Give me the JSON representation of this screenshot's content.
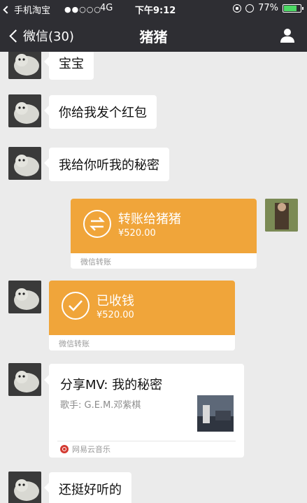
{
  "status_bar": {
    "carrier_back": "手机淘宝",
    "signal": "●●○○○",
    "network": "4G",
    "time": "下午9:12",
    "battery_percent": "77%",
    "battery_level": 0.77
  },
  "nav": {
    "back_label": "微信(30)",
    "title": "猪猪"
  },
  "messages": [
    {
      "type": "text",
      "from": "other",
      "text": "宝宝"
    },
    {
      "type": "text",
      "from": "other",
      "text": "你给我发个红包"
    },
    {
      "type": "text",
      "from": "other",
      "text": "我给你听我的秘密"
    },
    {
      "type": "transfer",
      "from": "me",
      "title": "转账给猪猪",
      "amount": "¥520.00",
      "footer": "微信转账"
    },
    {
      "type": "transfer",
      "from": "other",
      "title": "已收钱",
      "amount": "¥520.00",
      "footer": "微信转账"
    },
    {
      "type": "music",
      "from": "other",
      "title": "分享MV: 我的秘密",
      "artist": "歌手: G.E.M.邓紫棋",
      "source": "网易云音乐"
    },
    {
      "type": "text",
      "from": "other",
      "text": "还挺好听的"
    }
  ],
  "colors": {
    "bar_bg": "#2e2e33",
    "chat_bg": "#ebebeb",
    "transfer_orange": "#f0a53a",
    "battery_green": "#4cd964"
  },
  "icons": [
    "back-chevron-icon",
    "profile-icon",
    "transfer-arrows-icon",
    "check-icon",
    "netease-music-icon",
    "lock-rotation-icon",
    "alarm-icon",
    "battery-icon"
  ]
}
